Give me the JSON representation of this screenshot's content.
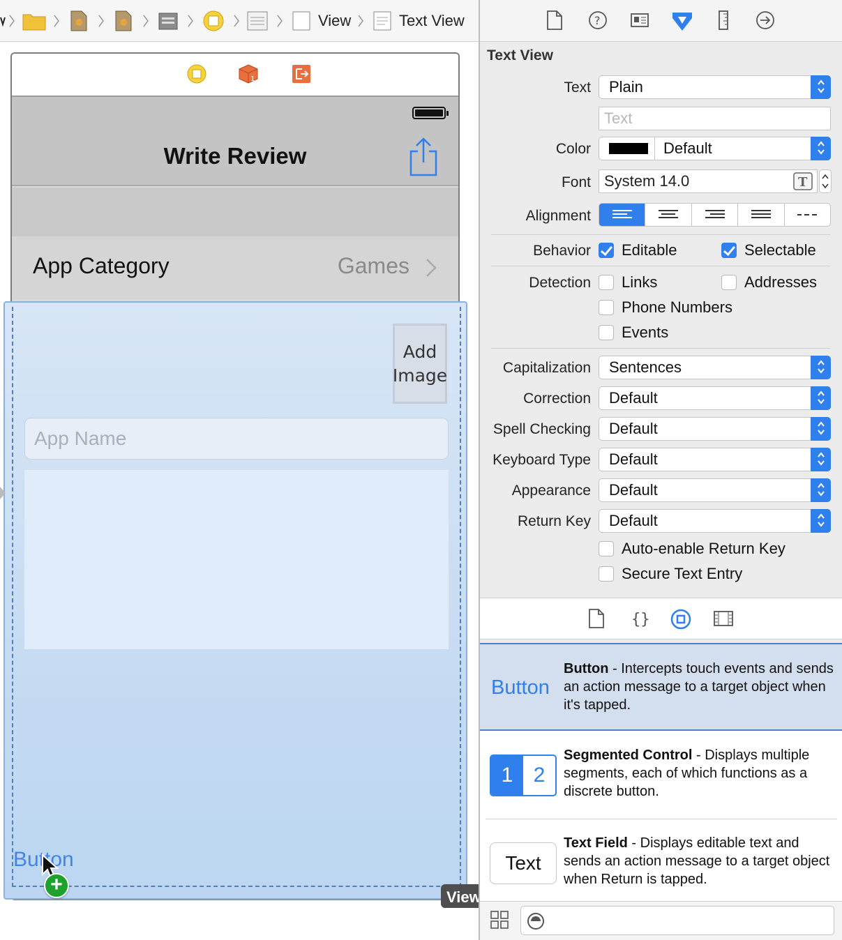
{
  "jumpbar": {
    "crumbs": [
      "View",
      "Text View"
    ]
  },
  "scene": {
    "dock_icons": [
      "view-controller-icon",
      "first-responder-icon",
      "exit-icon"
    ],
    "nav_title": "Write Review",
    "category_label": "App Category",
    "category_value": "Games",
    "add_image_line1": "Add",
    "add_image_line2": "Image",
    "app_name_placeholder": "App Name",
    "button_label": "Button",
    "view_tag": "View"
  },
  "inspector": {
    "section_title": "Text View",
    "text_label": "Text",
    "text_value": "Plain",
    "text_placeholder": "Text",
    "color_label": "Color",
    "color_value": "Default",
    "color_swatch": "#000000",
    "font_label": "Font",
    "font_value": "System 14.0",
    "alignment_label": "Alignment",
    "behavior_label": "Behavior",
    "editable_label": "Editable",
    "editable_checked": true,
    "selectable_label": "Selectable",
    "selectable_checked": true,
    "detection_label": "Detection",
    "links_label": "Links",
    "addresses_label": "Addresses",
    "phone_label": "Phone Numbers",
    "events_label": "Events",
    "capitalization_label": "Capitalization",
    "capitalization_value": "Sentences",
    "correction_label": "Correction",
    "correction_value": "Default",
    "spell_label": "Spell Checking",
    "spell_value": "Default",
    "keyboard_label": "Keyboard Type",
    "keyboard_value": "Default",
    "appearance_label": "Appearance",
    "appearance_value": "Default",
    "return_label": "Return Key",
    "return_value": "Default",
    "auto_return_label": "Auto-enable Return Key",
    "secure_label": "Secure Text Entry"
  },
  "library": {
    "items": [
      {
        "preview": "Button",
        "title": "Button",
        "desc": " - Intercepts touch events and sends an action message to a target object when it's tapped."
      },
      {
        "preview_1": "1",
        "preview_2": "2",
        "title": "Segmented Control",
        "desc": " - Displays multiple segments, each of which functions as a discrete button."
      },
      {
        "preview": "Text",
        "title": "Text Field",
        "desc": " - Displays editable text and sends an action message to a target object when Return is tapped."
      }
    ]
  },
  "colors": {
    "accent": "#2f7fec",
    "selection": "#4f7fc3",
    "add_green": "#1fa12d"
  }
}
